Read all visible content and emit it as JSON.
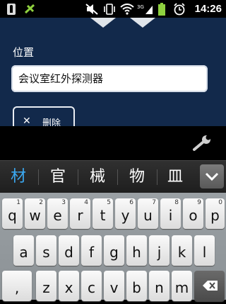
{
  "status_bar": {
    "time": "14:26",
    "icons": [
      "usb-debug-icon",
      "usb-icon",
      "mute-icon",
      "vibrate-icon",
      "wifi-icon",
      "signal-3g-icon",
      "battery-icon",
      "alarm-icon"
    ]
  },
  "form": {
    "location_label": "位置",
    "location_value": "会议室红外探测器",
    "delete_label": "删除"
  },
  "candidates": [
    "材",
    "官",
    "械",
    "物",
    "皿"
  ],
  "keyboard": {
    "row1": [
      {
        "main": "q",
        "sub": "1"
      },
      {
        "main": "w",
        "sub": "2"
      },
      {
        "main": "e",
        "sub": "3"
      },
      {
        "main": "r",
        "sub": "4"
      },
      {
        "main": "t",
        "sub": "5"
      },
      {
        "main": "y",
        "sub": "6"
      },
      {
        "main": "u",
        "sub": "7"
      },
      {
        "main": "i",
        "sub": "8"
      },
      {
        "main": "o",
        "sub": "9"
      },
      {
        "main": "p",
        "sub": "0"
      }
    ],
    "row2": [
      "a",
      "s",
      "d",
      "f",
      "g",
      "h",
      "j",
      "k",
      "l"
    ],
    "row3": [
      ",",
      "z",
      "x",
      "c",
      "v",
      "b",
      "n",
      "m"
    ]
  },
  "colors": {
    "app_background": "#12294b",
    "candidate_highlight": "#3ba8f0"
  }
}
